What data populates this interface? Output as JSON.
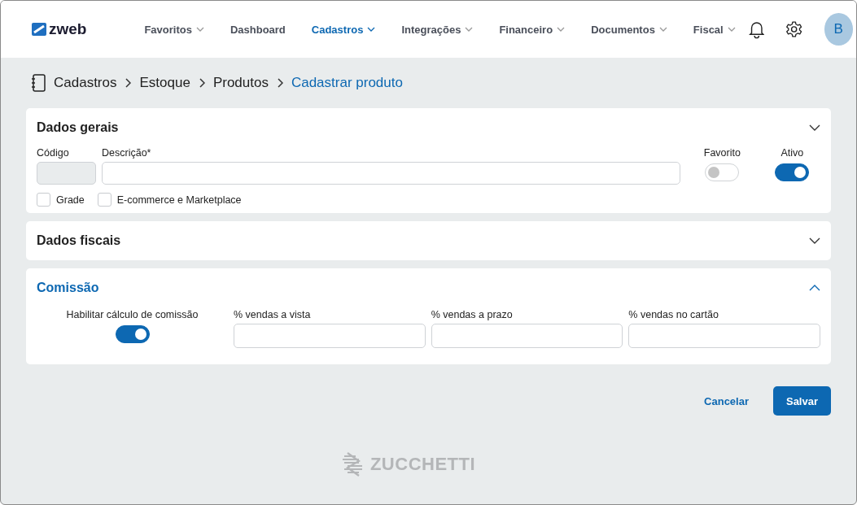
{
  "header": {
    "logo": "zweb",
    "nav": [
      {
        "label": "Favoritos",
        "selected": false,
        "dropdown": true
      },
      {
        "label": "Dashboard",
        "selected": false,
        "dropdown": false
      },
      {
        "label": "Cadastros",
        "selected": true,
        "dropdown": true
      },
      {
        "label": "Integrações",
        "selected": false,
        "dropdown": true
      },
      {
        "label": "Financeiro",
        "selected": false,
        "dropdown": true
      },
      {
        "label": "Documentos",
        "selected": false,
        "dropdown": true
      },
      {
        "label": "Fiscal",
        "selected": false,
        "dropdown": true
      }
    ],
    "avatar": "B"
  },
  "breadcrumb": [
    "Cadastros",
    "Estoque",
    "Produtos",
    "Cadastrar produto"
  ],
  "sections": [
    {
      "kind": "general",
      "title": "Dados gerais",
      "active": false,
      "fields": [
        {
          "label": "Código",
          "disabled": true
        },
        {
          "label": "Descrição*",
          "disabled": false
        }
      ],
      "toggles": [
        {
          "label": "Favorito",
          "on": false
        },
        {
          "label": "Ativo",
          "on": true
        }
      ],
      "checkboxes": [
        {
          "label": "Grade",
          "checked": false
        },
        {
          "label": "E-commerce e Marketplace",
          "checked": false
        }
      ]
    },
    {
      "kind": "collapsed",
      "title": "Dados fiscais",
      "active": false
    },
    {
      "kind": "commission",
      "title": "Comissão",
      "active": true,
      "toggle": {
        "label": "Habilitar cálculo de comissão",
        "on": true
      },
      "fields": [
        {
          "label": "% vendas a vista"
        },
        {
          "label": "% vendas a prazo"
        },
        {
          "label": "% vendas no cartão"
        }
      ]
    }
  ],
  "buttons": {
    "cancel": "Cancelar",
    "save": "Salvar"
  },
  "footer_logo": "ZUCCHETTI"
}
